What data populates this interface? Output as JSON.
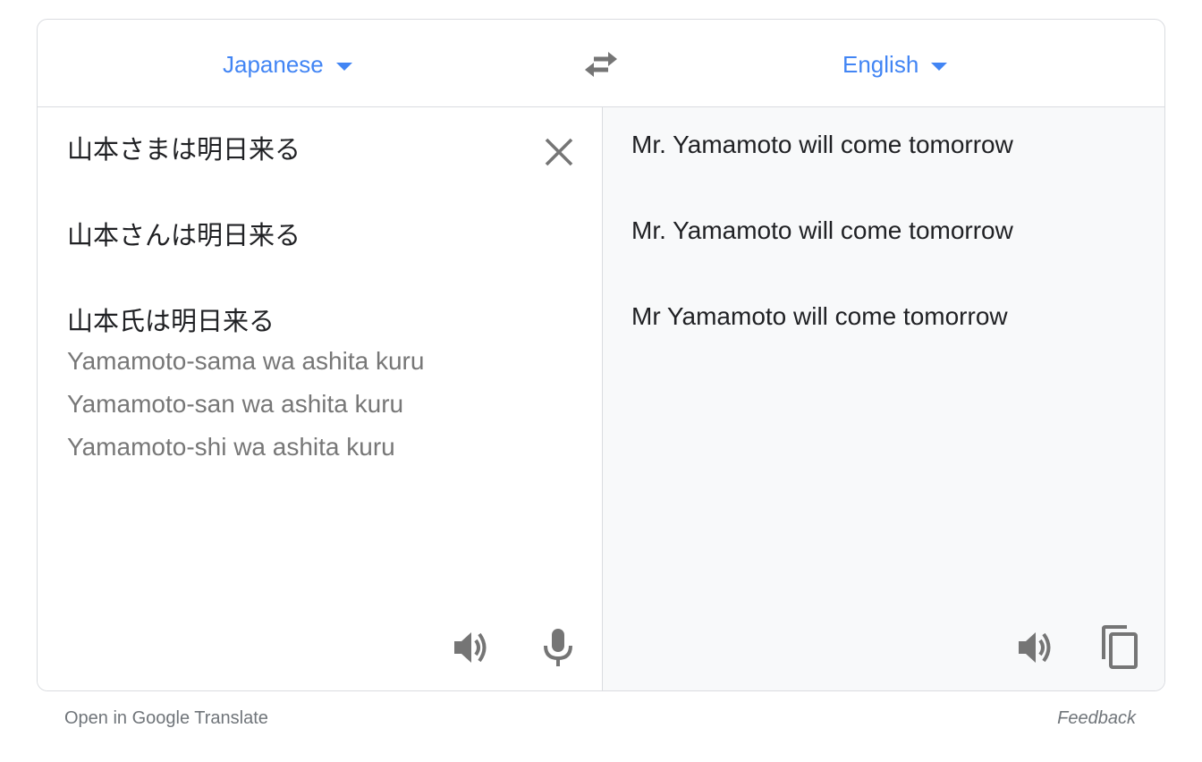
{
  "languages": {
    "source": "Japanese",
    "target": "English"
  },
  "source_lines": [
    "山本さまは明日来る",
    "山本さんは明日来る",
    "山本氏は明日来る"
  ],
  "transliteration_lines": [
    "Yamamoto-sama wa ashita kuru",
    "Yamamoto-san wa ashita kuru",
    "Yamamoto-shi wa ashita kuru"
  ],
  "translation_lines": [
    "Mr. Yamamoto will come tomorrow",
    "Mr. Yamamoto will come tomorrow",
    "Mr Yamamoto will come tomorrow"
  ],
  "footer": {
    "open_link": "Open in Google Translate",
    "feedback": "Feedback"
  },
  "icons": {
    "swap": "swap-arrows-icon",
    "clear": "close-icon",
    "listen": "speaker-icon",
    "mic": "microphone-icon",
    "copy": "copy-icon"
  },
  "colors": {
    "accent": "#4285f4",
    "icon": "#757575",
    "text": "#202124",
    "muted": "#777777",
    "target_bg": "#f8f9fa"
  }
}
